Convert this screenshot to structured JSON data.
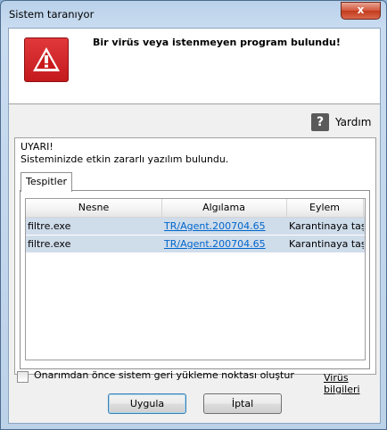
{
  "window": {
    "title": "Sistem taranıyor",
    "close_glyph": "x"
  },
  "header": {
    "message": "Bir virüs veya istenmeyen program bulundu!",
    "icon": "warning-triangle-icon",
    "icon_bg_color": "#c9191c"
  },
  "help": {
    "label": "Yardım",
    "icon_glyph": "?"
  },
  "panel": {
    "title": "UYARI!",
    "subtitle": "Sisteminizde etkin zararlı yazılım bulundu.",
    "tab": "Tespitler"
  },
  "table": {
    "columns": [
      "Nesne",
      "Algılama",
      "Eylem"
    ],
    "rows": [
      {
        "object": "filtre.exe",
        "detection": "TR/Agent.200704.65",
        "action": "Karantinaya taşı"
      },
      {
        "object": "filtre.exe",
        "detection": "TR/Agent.200704.65",
        "action": "Karantinaya taşı"
      }
    ]
  },
  "footer": {
    "checkbox_label": "Onarımdan önce sistem geri yükleme noktası oluştur",
    "checkbox_checked": false,
    "virus_info_link": "Virüs bilgileri"
  },
  "buttons": {
    "apply": "Uygula",
    "cancel": "İptal"
  }
}
